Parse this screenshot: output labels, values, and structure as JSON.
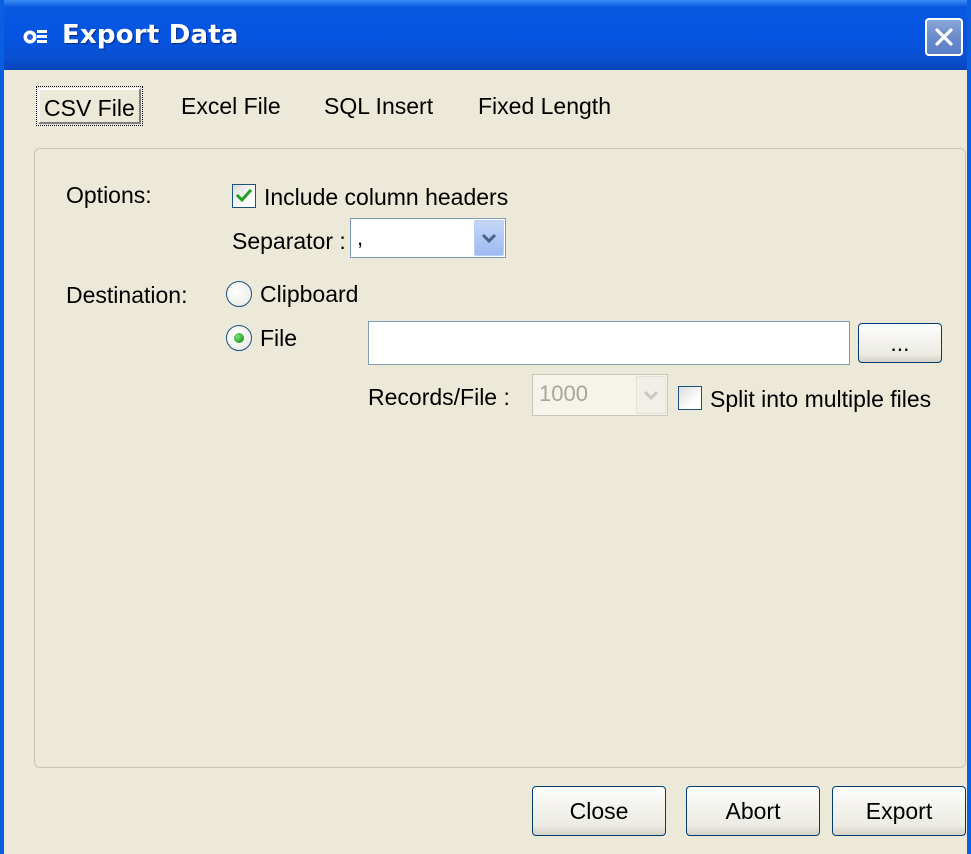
{
  "window": {
    "title": "Export Data",
    "app_icon": "gear-window-icon",
    "close_icon": "close-icon"
  },
  "tabs": [
    {
      "label": "CSV File",
      "selected": true
    },
    {
      "label": "Excel File",
      "selected": false
    },
    {
      "label": "SQL Insert",
      "selected": false
    },
    {
      "label": "Fixed Length",
      "selected": false
    }
  ],
  "options": {
    "label": "Options:",
    "include_headers_label": "Include column headers",
    "include_headers_checked": true,
    "separator_label": "Separator :",
    "separator_value": ","
  },
  "destination": {
    "label": "Destination:",
    "clipboard_label": "Clipboard",
    "file_label": "File",
    "selected": "File",
    "file_path": "",
    "browse_label": "...",
    "records_label": "Records/File :",
    "records_value": "1000",
    "split_label": "Split into multiple files",
    "split_checked": false
  },
  "buttons": {
    "close": "Close",
    "abort": "Abort",
    "export": "Export"
  },
  "colors": {
    "titlebar": "#0555e2",
    "dialog_bg": "#ece9d8",
    "checkmark": "#21a121"
  }
}
